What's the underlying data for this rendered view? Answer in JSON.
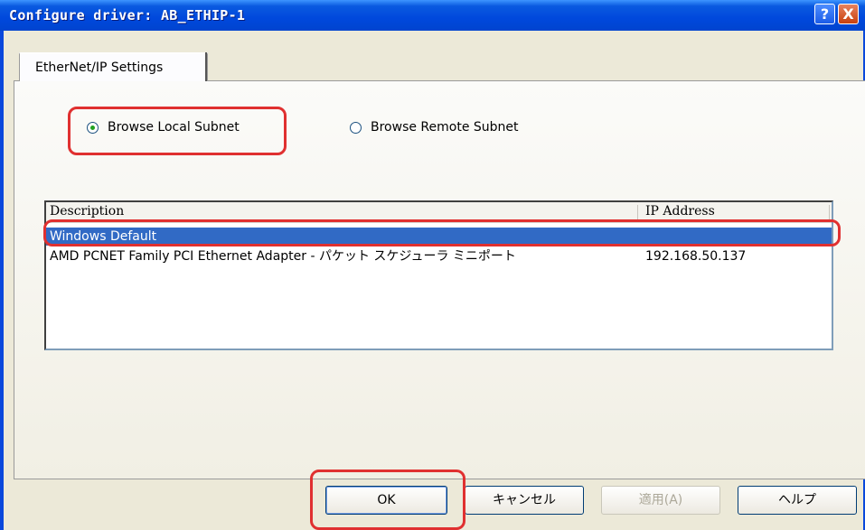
{
  "window": {
    "title": "Configure driver: AB_ETHIP-1",
    "help_icon": "?",
    "close_icon": "X"
  },
  "tabs": [
    {
      "label": "EtherNet/IP Settings",
      "active": true
    }
  ],
  "browse_mode": {
    "options": [
      {
        "label": "Browse Local Subnet",
        "checked": true
      },
      {
        "label": "Browse Remote Subnet",
        "checked": false
      }
    ]
  },
  "adapter_list": {
    "columns": [
      "Description",
      "IP Address"
    ],
    "rows": [
      {
        "description": "Windows Default",
        "ip": "",
        "selected": true
      },
      {
        "description": "AMD PCNET Family PCI Ethernet Adapter - パケット スケジューラ ミニポート",
        "ip": "192.168.50.137",
        "selected": false
      }
    ]
  },
  "buttons": {
    "ok": "OK",
    "cancel": "キャンセル",
    "apply": "適用(A)",
    "help": "ヘルプ"
  },
  "colors": {
    "titlebar": "#0048dc",
    "selection": "#316ac5",
    "highlight_annotation": "#e03030",
    "dialog_bg": "#ece9d8"
  }
}
